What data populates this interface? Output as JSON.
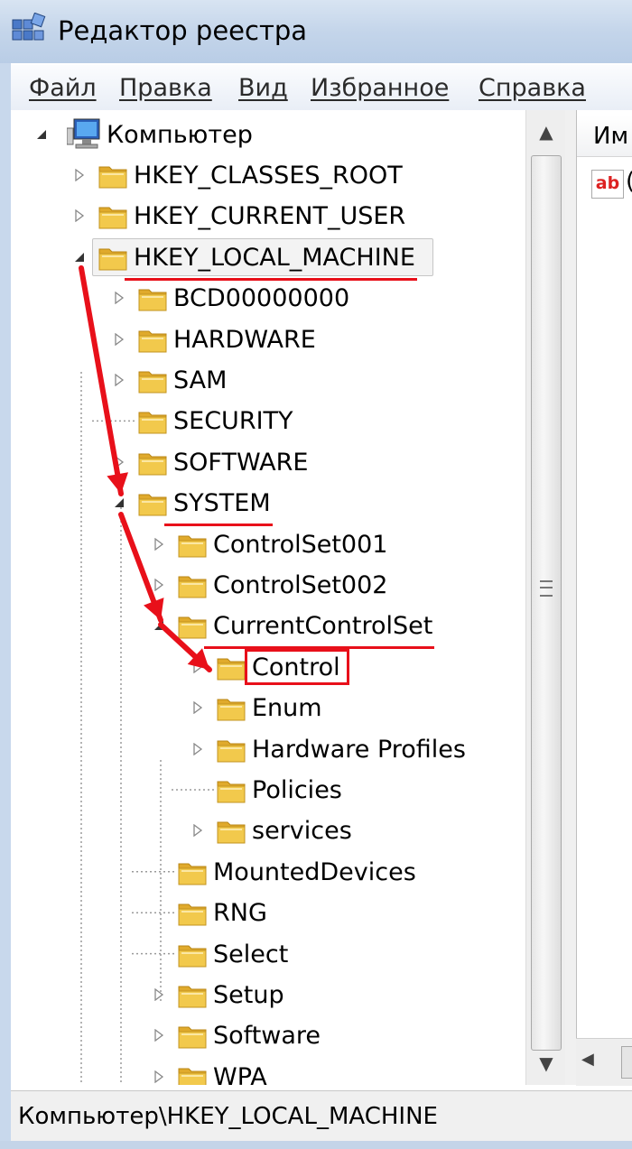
{
  "window": {
    "title": "Редактор реестра"
  },
  "menu": [
    "Файл",
    "Правка",
    "Вид",
    "Избранное",
    "Справка"
  ],
  "tree": {
    "root": "Компьютер",
    "items": [
      {
        "label": "HKEY_CLASSES_ROOT",
        "level": 1,
        "expander": "collapsed"
      },
      {
        "label": "HKEY_CURRENT_USER",
        "level": 1,
        "expander": "collapsed"
      },
      {
        "label": "HKEY_LOCAL_MACHINE",
        "level": 1,
        "expander": "expanded",
        "selected": true,
        "underlined": true
      },
      {
        "label": "BCD00000000",
        "level": 2,
        "expander": "collapsed"
      },
      {
        "label": "HARDWARE",
        "level": 2,
        "expander": "collapsed"
      },
      {
        "label": "SAM",
        "level": 2,
        "expander": "collapsed"
      },
      {
        "label": "SECURITY",
        "level": 2,
        "expander": "none"
      },
      {
        "label": "SOFTWARE",
        "level": 2,
        "expander": "collapsed"
      },
      {
        "label": "SYSTEM",
        "level": 2,
        "expander": "expanded",
        "underlined": true
      },
      {
        "label": "ControlSet001",
        "level": 3,
        "expander": "collapsed"
      },
      {
        "label": "ControlSet002",
        "level": 3,
        "expander": "collapsed"
      },
      {
        "label": "CurrentControlSet",
        "level": 3,
        "expander": "expanded",
        "underlined": true
      },
      {
        "label": "Control",
        "level": 4,
        "expander": "collapsed",
        "boxed": true
      },
      {
        "label": "Enum",
        "level": 4,
        "expander": "collapsed"
      },
      {
        "label": "Hardware Profiles",
        "level": 4,
        "expander": "collapsed"
      },
      {
        "label": "Policies",
        "level": 4,
        "expander": "none"
      },
      {
        "label": "services",
        "level": 4,
        "expander": "collapsed"
      },
      {
        "label": "MountedDevices",
        "level": 3,
        "expander": "none"
      },
      {
        "label": "RNG",
        "level": 3,
        "expander": "none"
      },
      {
        "label": "Select",
        "level": 3,
        "expander": "none"
      },
      {
        "label": "Setup",
        "level": 3,
        "expander": "collapsed"
      },
      {
        "label": "Software",
        "level": 3,
        "expander": "collapsed"
      },
      {
        "label": "WPA",
        "level": 3,
        "expander": "collapsed"
      }
    ]
  },
  "list": {
    "column_header": "Им",
    "value_icon": "ab-string-icon",
    "first_value_fragment": "("
  },
  "status": {
    "path": "Компьютер\\HKEY_LOCAL_MACHINE"
  },
  "colors": {
    "annotation_red": "#e8101a",
    "folder_yellow": "#f2c94c"
  }
}
